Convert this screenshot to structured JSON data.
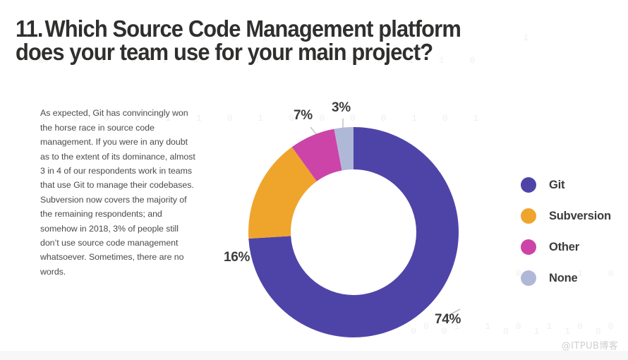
{
  "title": {
    "number": "11.",
    "text": "Which Source Code Management platform does your team use for your main project?"
  },
  "body_copy": {
    "text": "As expected, Git has convincingly won the horse race in source code management. If you were in any doubt as to the extent of its dominance, almost 3 in 4 of our respondents work in teams that use Git to manage their codebases. Subversion now covers the majority of the remaining respondents; and somehow in 2018, 3% of people still don’t use source code management whatsoever. Sometimes, there are no words."
  },
  "legend": {
    "items": [
      {
        "label": "Git",
        "color": "#4e44a8"
      },
      {
        "label": "Subversion",
        "color": "#efa52c"
      },
      {
        "label": "Other",
        "color": "#cc44a8"
      },
      {
        "label": "None",
        "color": "#b0b8d8"
      }
    ]
  },
  "labels": {
    "git": "74%",
    "subversion": "16%",
    "other": "7%",
    "none": "3%"
  },
  "watermark": "@ITPUB博客",
  "background_pattern": {
    "rows": [
      "0 1 1 0 1 0 0 1 0 0 0 0 1 1 0",
      "0 0 0 0 1 1 0 1 0 0 0 0 1 0 1",
      "0 0 0 1 1 0 0 0        1      ",
      "      0   1 0   1 0   0 1 0   ",
      "  1 0 0   0 1 1 0   0 1   1 0 "
    ]
  },
  "chart_data": {
    "type": "pie",
    "variant": "donut",
    "title": "Which Source Code Management platform does your team use for your main project?",
    "categories": [
      "Git",
      "Subversion",
      "Other",
      "None"
    ],
    "values": [
      74,
      16,
      7,
      3
    ],
    "unit": "%",
    "colors": [
      "#4e44a8",
      "#efa52c",
      "#cc44a8",
      "#b0b8d8"
    ],
    "data_labels": [
      "74%",
      "16%",
      "7%",
      "3%"
    ],
    "start_angle_deg": 0,
    "direction": "clockwise",
    "inner_radius_ratio": 0.6,
    "legend_position": "right",
    "grid": false,
    "xlabel": "",
    "ylabel": ""
  }
}
